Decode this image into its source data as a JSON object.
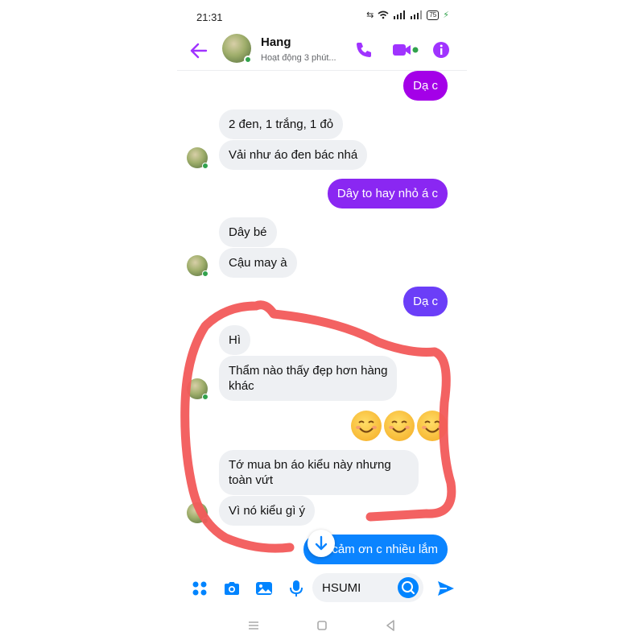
{
  "status_bar": {
    "time": "21:31",
    "battery": "75"
  },
  "header": {
    "name": "Hang",
    "status": "Hoạt động 3 phút..."
  },
  "messages": [
    {
      "text": "Dạ c"
    },
    {
      "text": "2 đen, 1 trắng, 1 đỏ"
    },
    {
      "text": "Vải như áo đen bác nhá"
    },
    {
      "text": "Dây to hay nhỏ á c"
    },
    {
      "text": "Dây bé"
    },
    {
      "text": "Cậu may à"
    },
    {
      "text": "Dạ c"
    },
    {
      "text": "Hì"
    },
    {
      "line1": "Thẩm nào thấy đẹp hơn hàng",
      "line2": "khác"
    },
    {
      "text": "Tớ mua bn áo kiểu này nhưng toàn vứt"
    },
    {
      "text": "Vì nó kiểu gì ý"
    },
    {
      "text": "Dạ cảm ơn c nhiều lắm"
    }
  ],
  "composer": {
    "input_value": "HSUMI"
  },
  "colors": {
    "accent": "#a033ff",
    "out_purple_top": "#a400e8",
    "out_purple_mid": "#7b2ff7",
    "out_blue": "#0b84ff",
    "incoming_bg": "#eef0f3",
    "online": "#31a24c",
    "annotation": "#f25a5a"
  },
  "icons": [
    "back-arrow-icon",
    "phone-icon",
    "video-icon",
    "info-icon",
    "menu-dots-icon",
    "camera-icon",
    "gallery-icon",
    "microphone-icon",
    "emoji-icon",
    "send-icon",
    "scroll-down-icon",
    "smiling-emoji-icon"
  ]
}
